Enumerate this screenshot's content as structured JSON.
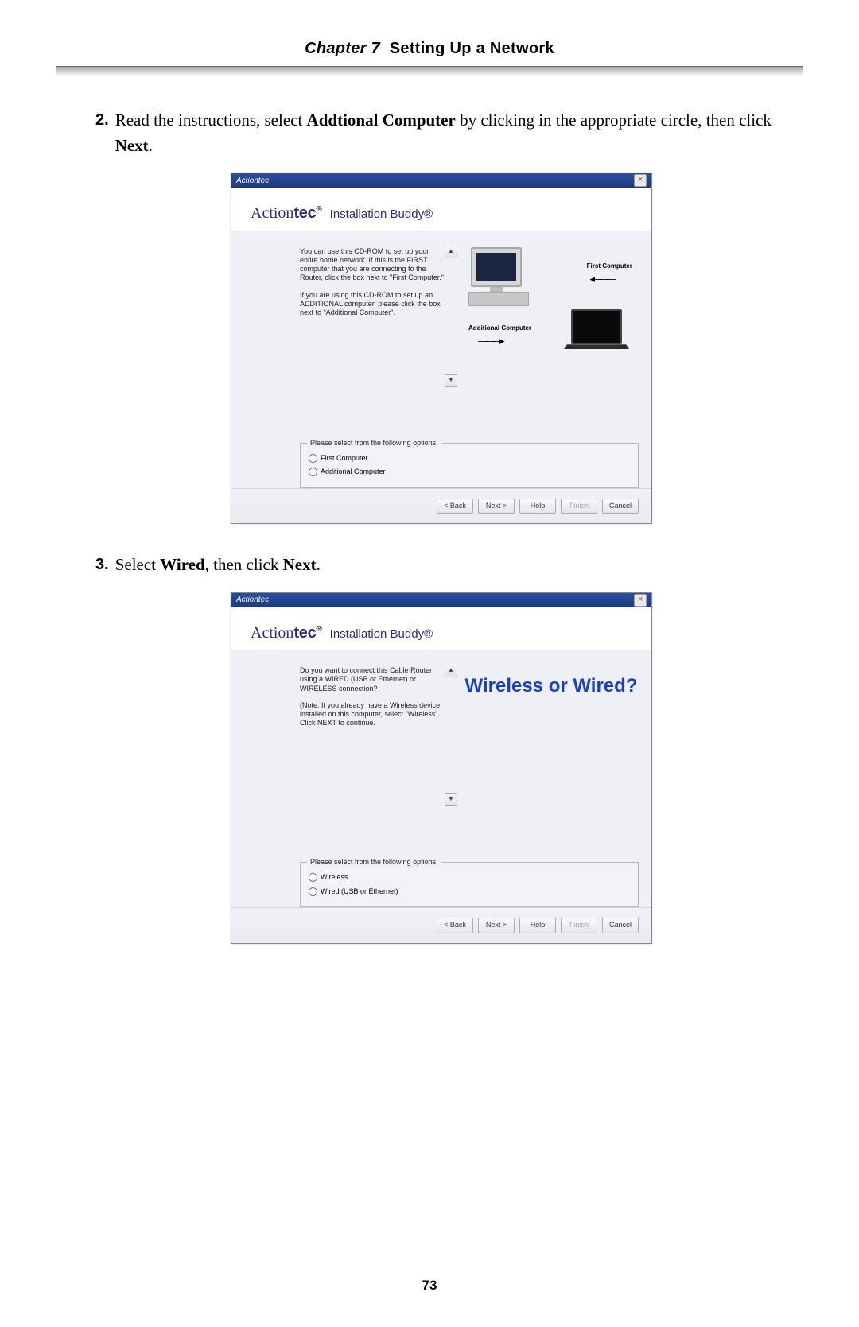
{
  "header": {
    "chapter_label": "Chapter 7",
    "chapter_title": "Setting Up a Network"
  },
  "steps": [
    {
      "number": "2.",
      "text_parts": [
        "Read the instructions, select ",
        "Addtional Computer",
        " by clicking in the appropriate circle, then click ",
        "Next",
        "."
      ]
    },
    {
      "number": "3.",
      "text_parts": [
        "Select ",
        "Wired",
        ", then click ",
        "Next",
        "."
      ]
    }
  ],
  "dialog_common": {
    "titlebar": "Actiontec",
    "brand_prefix": "Action",
    "brand_suffix": "tec",
    "brand_reg": "®",
    "subtitle": "Installation Buddy®",
    "options_legend": "Please select from the following options:",
    "buttons": {
      "back": "< Back",
      "next": "Next >",
      "help": "Help",
      "finish": "Finish",
      "cancel": "Cancel"
    }
  },
  "dialog1": {
    "para1": "You can use this CD-ROM to set up your entire home network. If this is the FIRST computer that you are connecting to the Router, click the box next to \"First Computer.\"",
    "para2": "If you are using this CD-ROM to set up an ADDITIONAL computer, please click the box next to \"Additional Computer\".",
    "label_first": "First Computer",
    "label_additional": "Additional Computer",
    "options": [
      "First Computer",
      "Additional Computer"
    ]
  },
  "dialog2": {
    "para1": "Do you want to connect this Cable Router using a WIRED (USB or Ethernet) or WIRELESS connection?",
    "para2": "(Note: If you already have a Wireless device installed on this computer, select \"Wireless\". Click NEXT to continue.",
    "big_text": "Wireless or Wired?",
    "options": [
      "Wireless",
      "Wired (USB or Ethernet)"
    ]
  },
  "page_number": "73"
}
